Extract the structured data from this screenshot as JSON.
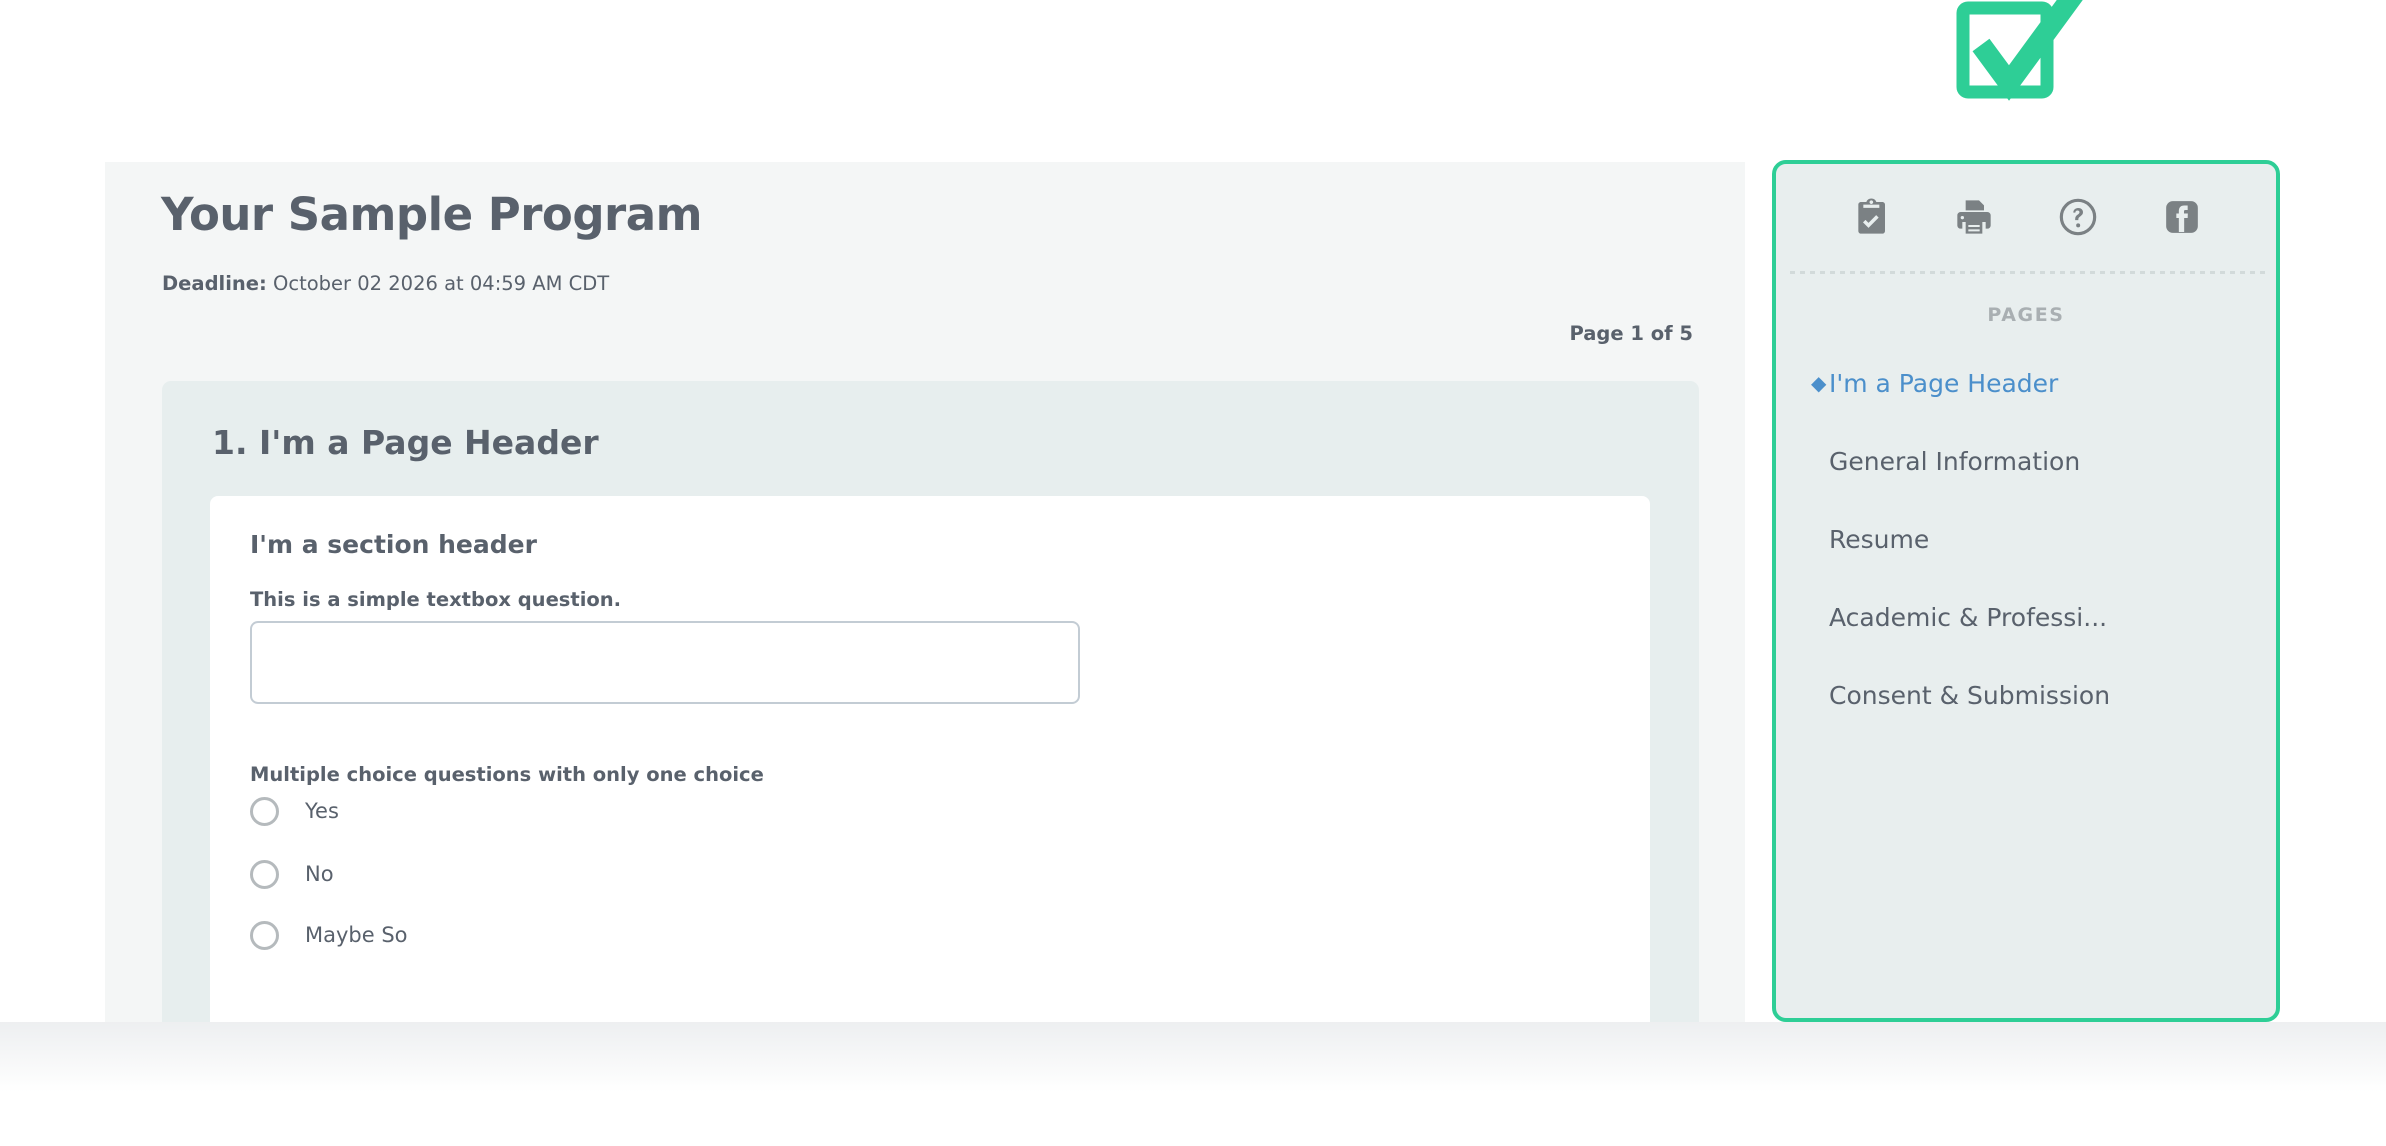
{
  "brand": {
    "logo_icon": "checkbox-check-logo",
    "accent_green": "#2ECE96",
    "accent_blue": "#4B8FCB",
    "text_gray": "#59616C"
  },
  "header": {
    "program_title": "Your Sample Program",
    "deadline_label": "Deadline:",
    "deadline_value": "October 02 2026 at 04:59 AM CDT",
    "page_counter": "Page 1 of 5"
  },
  "page_block": {
    "page_header": "1. I'm a Page Header",
    "section_header": "I'm a section header",
    "questions": [
      {
        "type": "textbox",
        "label": "This is a simple textbox question.",
        "value": "",
        "placeholder": ""
      },
      {
        "type": "radio",
        "label": "Multiple choice questions with only one choice",
        "options": [
          "Yes",
          "No",
          "Maybe So"
        ],
        "selected": null
      }
    ]
  },
  "sidebar": {
    "icons": [
      {
        "name": "clipboard-check-icon"
      },
      {
        "name": "printer-icon"
      },
      {
        "name": "help-circle-icon"
      },
      {
        "name": "facebook-icon"
      }
    ],
    "pages_title": "PAGES",
    "active_bullet": "◆",
    "items": [
      {
        "label": "I'm a Page Header",
        "active": true
      },
      {
        "label": "General Information",
        "active": false
      },
      {
        "label": "Resume",
        "active": false
      },
      {
        "label": "Academic & Professi...",
        "active": false
      },
      {
        "label": "Consent & Submission",
        "active": false
      }
    ]
  }
}
